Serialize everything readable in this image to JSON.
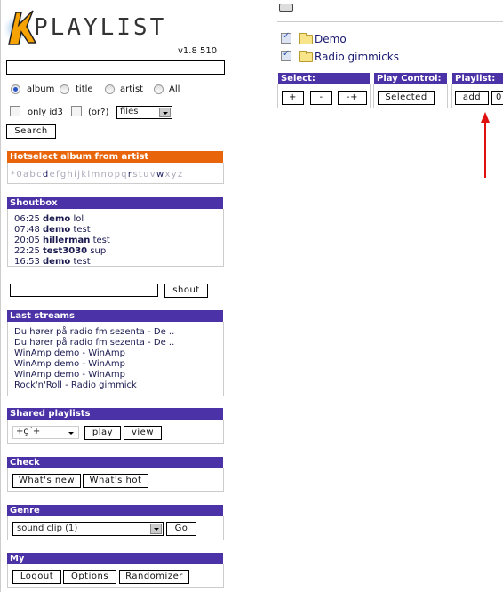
{
  "app": {
    "logo_text": "KPLAYLIST",
    "version": "v1.8 510"
  },
  "search": {
    "query": "",
    "radios": [
      {
        "label": "album",
        "checked": true
      },
      {
        "label": "title",
        "checked": false
      },
      {
        "label": "artist",
        "checked": false
      },
      {
        "label": "All",
        "checked": false
      }
    ],
    "only_id3_label": "only id3",
    "or_label": "(or?)",
    "type_select": "files",
    "search_button": "Search"
  },
  "hotselect": {
    "title": "Hotselect album from artist",
    "letters": [
      {
        "c": "*",
        "active": false
      },
      {
        "c": "0",
        "active": false
      },
      {
        "c": "a",
        "active": false
      },
      {
        "c": "b",
        "active": false
      },
      {
        "c": "c",
        "active": false
      },
      {
        "c": "d",
        "active": true
      },
      {
        "c": "e",
        "active": false
      },
      {
        "c": "f",
        "active": false
      },
      {
        "c": "g",
        "active": false
      },
      {
        "c": "h",
        "active": false
      },
      {
        "c": "i",
        "active": false
      },
      {
        "c": "j",
        "active": false
      },
      {
        "c": "k",
        "active": false
      },
      {
        "c": "l",
        "active": false
      },
      {
        "c": "m",
        "active": false
      },
      {
        "c": "n",
        "active": false
      },
      {
        "c": "o",
        "active": false
      },
      {
        "c": "p",
        "active": false
      },
      {
        "c": "q",
        "active": false
      },
      {
        "c": "r",
        "active": true
      },
      {
        "c": "s",
        "active": false
      },
      {
        "c": "t",
        "active": false
      },
      {
        "c": "u",
        "active": false
      },
      {
        "c": "v",
        "active": false
      },
      {
        "c": "w",
        "active": true
      },
      {
        "c": "x",
        "active": false
      },
      {
        "c": "y",
        "active": false
      },
      {
        "c": "z",
        "active": false
      }
    ]
  },
  "shoutbox": {
    "title": "Shoutbox",
    "messages": [
      {
        "time": "06:25",
        "user": "demo",
        "text": "lol"
      },
      {
        "time": "07:48",
        "user": "demo",
        "text": "test"
      },
      {
        "time": "20:05",
        "user": "hillerman",
        "text": "test"
      },
      {
        "time": "22:25",
        "user": "test3030",
        "text": "sup"
      },
      {
        "time": "16:53",
        "user": "demo",
        "text": "test"
      }
    ],
    "input": "",
    "shout_button": "shout"
  },
  "last_streams": {
    "title": "Last streams",
    "items": [
      "Du hører på radio fm sezenta - De ..",
      "Du hører på radio fm sezenta - De ..",
      "WinAmp demo - WinAmp",
      "WinAmp demo - WinAmp",
      "WinAmp demo - WinAmp",
      "Rock'n'Roll - Radio gimmick"
    ]
  },
  "shared_playlists": {
    "title": "Shared playlists",
    "selected": "+ç´+",
    "play_button": "play",
    "view_button": "view"
  },
  "check": {
    "title": "Check",
    "new_button": "What's new",
    "hot_button": "What's hot"
  },
  "genre": {
    "title": "Genre",
    "selected": "sound clip (1)",
    "go_button": "Go"
  },
  "my": {
    "title": "My",
    "logout_button": "Logout",
    "options_button": "Options",
    "randomizer_button": "Randomizer"
  },
  "main": {
    "folders": [
      {
        "name": "Demo",
        "checked": true
      },
      {
        "name": "Radio gimmicks",
        "checked": true
      }
    ],
    "select": {
      "title": "Select:",
      "buttons": [
        "+",
        "-",
        "-+"
      ]
    },
    "play_control": {
      "title": "Play Control:",
      "selected_button": "Selected"
    },
    "playlist": {
      "title": "Playlist:",
      "add_button": "add",
      "value": "0"
    }
  },
  "colors": {
    "header": "#4b32a6",
    "hotselect_header": "#e8650c",
    "annotation_arrow": "#e01010"
  }
}
